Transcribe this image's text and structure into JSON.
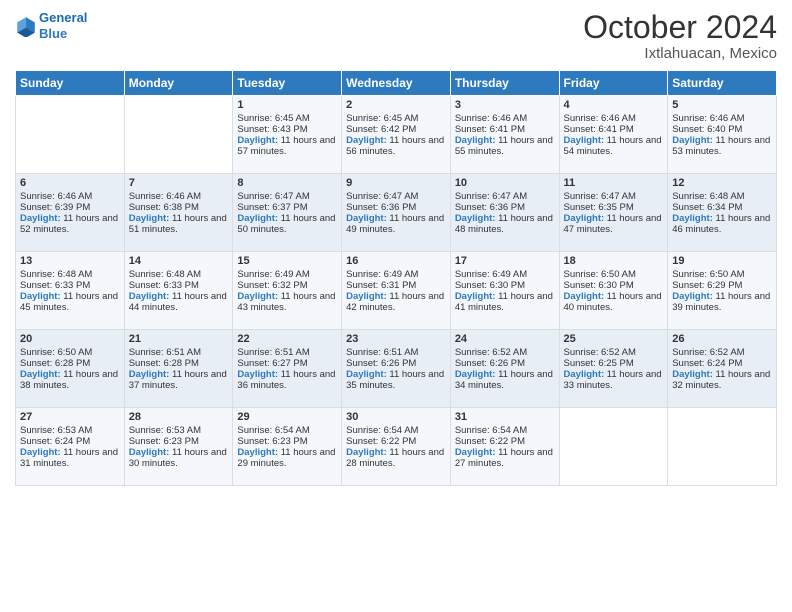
{
  "header": {
    "logo_line1": "General",
    "logo_line2": "Blue",
    "month": "October 2024",
    "location": "Ixtlahuacan, Mexico"
  },
  "weekdays": [
    "Sunday",
    "Monday",
    "Tuesday",
    "Wednesday",
    "Thursday",
    "Friday",
    "Saturday"
  ],
  "weeks": [
    [
      null,
      null,
      {
        "day": 1,
        "sunrise": "6:45 AM",
        "sunset": "6:43 PM",
        "daylight": "11 hours and 57 minutes."
      },
      {
        "day": 2,
        "sunrise": "6:45 AM",
        "sunset": "6:42 PM",
        "daylight": "11 hours and 56 minutes."
      },
      {
        "day": 3,
        "sunrise": "6:46 AM",
        "sunset": "6:41 PM",
        "daylight": "11 hours and 55 minutes."
      },
      {
        "day": 4,
        "sunrise": "6:46 AM",
        "sunset": "6:41 PM",
        "daylight": "11 hours and 54 minutes."
      },
      {
        "day": 5,
        "sunrise": "6:46 AM",
        "sunset": "6:40 PM",
        "daylight": "11 hours and 53 minutes."
      }
    ],
    [
      {
        "day": 6,
        "sunrise": "6:46 AM",
        "sunset": "6:39 PM",
        "daylight": "11 hours and 52 minutes."
      },
      {
        "day": 7,
        "sunrise": "6:46 AM",
        "sunset": "6:38 PM",
        "daylight": "11 hours and 51 minutes."
      },
      {
        "day": 8,
        "sunrise": "6:47 AM",
        "sunset": "6:37 PM",
        "daylight": "11 hours and 50 minutes."
      },
      {
        "day": 9,
        "sunrise": "6:47 AM",
        "sunset": "6:36 PM",
        "daylight": "11 hours and 49 minutes."
      },
      {
        "day": 10,
        "sunrise": "6:47 AM",
        "sunset": "6:36 PM",
        "daylight": "11 hours and 48 minutes."
      },
      {
        "day": 11,
        "sunrise": "6:47 AM",
        "sunset": "6:35 PM",
        "daylight": "11 hours and 47 minutes."
      },
      {
        "day": 12,
        "sunrise": "6:48 AM",
        "sunset": "6:34 PM",
        "daylight": "11 hours and 46 minutes."
      }
    ],
    [
      {
        "day": 13,
        "sunrise": "6:48 AM",
        "sunset": "6:33 PM",
        "daylight": "11 hours and 45 minutes."
      },
      {
        "day": 14,
        "sunrise": "6:48 AM",
        "sunset": "6:33 PM",
        "daylight": "11 hours and 44 minutes."
      },
      {
        "day": 15,
        "sunrise": "6:49 AM",
        "sunset": "6:32 PM",
        "daylight": "11 hours and 43 minutes."
      },
      {
        "day": 16,
        "sunrise": "6:49 AM",
        "sunset": "6:31 PM",
        "daylight": "11 hours and 42 minutes."
      },
      {
        "day": 17,
        "sunrise": "6:49 AM",
        "sunset": "6:30 PM",
        "daylight": "11 hours and 41 minutes."
      },
      {
        "day": 18,
        "sunrise": "6:50 AM",
        "sunset": "6:30 PM",
        "daylight": "11 hours and 40 minutes."
      },
      {
        "day": 19,
        "sunrise": "6:50 AM",
        "sunset": "6:29 PM",
        "daylight": "11 hours and 39 minutes."
      }
    ],
    [
      {
        "day": 20,
        "sunrise": "6:50 AM",
        "sunset": "6:28 PM",
        "daylight": "11 hours and 38 minutes."
      },
      {
        "day": 21,
        "sunrise": "6:51 AM",
        "sunset": "6:28 PM",
        "daylight": "11 hours and 37 minutes."
      },
      {
        "day": 22,
        "sunrise": "6:51 AM",
        "sunset": "6:27 PM",
        "daylight": "11 hours and 36 minutes."
      },
      {
        "day": 23,
        "sunrise": "6:51 AM",
        "sunset": "6:26 PM",
        "daylight": "11 hours and 35 minutes."
      },
      {
        "day": 24,
        "sunrise": "6:52 AM",
        "sunset": "6:26 PM",
        "daylight": "11 hours and 34 minutes."
      },
      {
        "day": 25,
        "sunrise": "6:52 AM",
        "sunset": "6:25 PM",
        "daylight": "11 hours and 33 minutes."
      },
      {
        "day": 26,
        "sunrise": "6:52 AM",
        "sunset": "6:24 PM",
        "daylight": "11 hours and 32 minutes."
      }
    ],
    [
      {
        "day": 27,
        "sunrise": "6:53 AM",
        "sunset": "6:24 PM",
        "daylight": "11 hours and 31 minutes."
      },
      {
        "day": 28,
        "sunrise": "6:53 AM",
        "sunset": "6:23 PM",
        "daylight": "11 hours and 30 minutes."
      },
      {
        "day": 29,
        "sunrise": "6:54 AM",
        "sunset": "6:23 PM",
        "daylight": "11 hours and 29 minutes."
      },
      {
        "day": 30,
        "sunrise": "6:54 AM",
        "sunset": "6:22 PM",
        "daylight": "11 hours and 28 minutes."
      },
      {
        "day": 31,
        "sunrise": "6:54 AM",
        "sunset": "6:22 PM",
        "daylight": "11 hours and 27 minutes."
      },
      null,
      null
    ]
  ]
}
